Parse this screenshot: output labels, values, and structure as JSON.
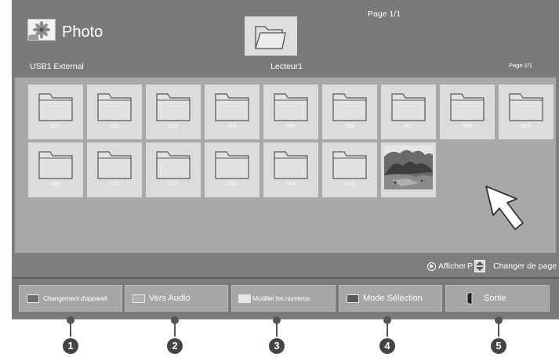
{
  "header": {
    "app_title": "Photo",
    "device_name": "USB1 External",
    "folder_name": "Lecteur1",
    "page_top": "Page 1/1",
    "page_right": "Page 1/1"
  },
  "grid": {
    "folders": [
      "001",
      "002",
      "003",
      "004",
      "005",
      "006",
      "007",
      "008",
      "009",
      "010",
      "011",
      "012",
      "013",
      "014",
      "015"
    ],
    "has_photo_thumbnail": true
  },
  "hints": {
    "show_label": "Afficher",
    "p_label": "P",
    "change_page_label": "Changer de page"
  },
  "buttons": [
    {
      "label": "Changement d'appareil",
      "color": "#6f6f6f"
    },
    {
      "label": "Vers Audio",
      "color": "#b0b0b0"
    },
    {
      "label": "Modifier les numéros",
      "color": "#e6e6e6"
    },
    {
      "label": "Mode Sélection",
      "color": "#5a5a5a"
    },
    {
      "label": "Sortie",
      "icon": "exit-door-icon"
    }
  ],
  "callouts": [
    "1",
    "2",
    "3",
    "4",
    "5"
  ]
}
